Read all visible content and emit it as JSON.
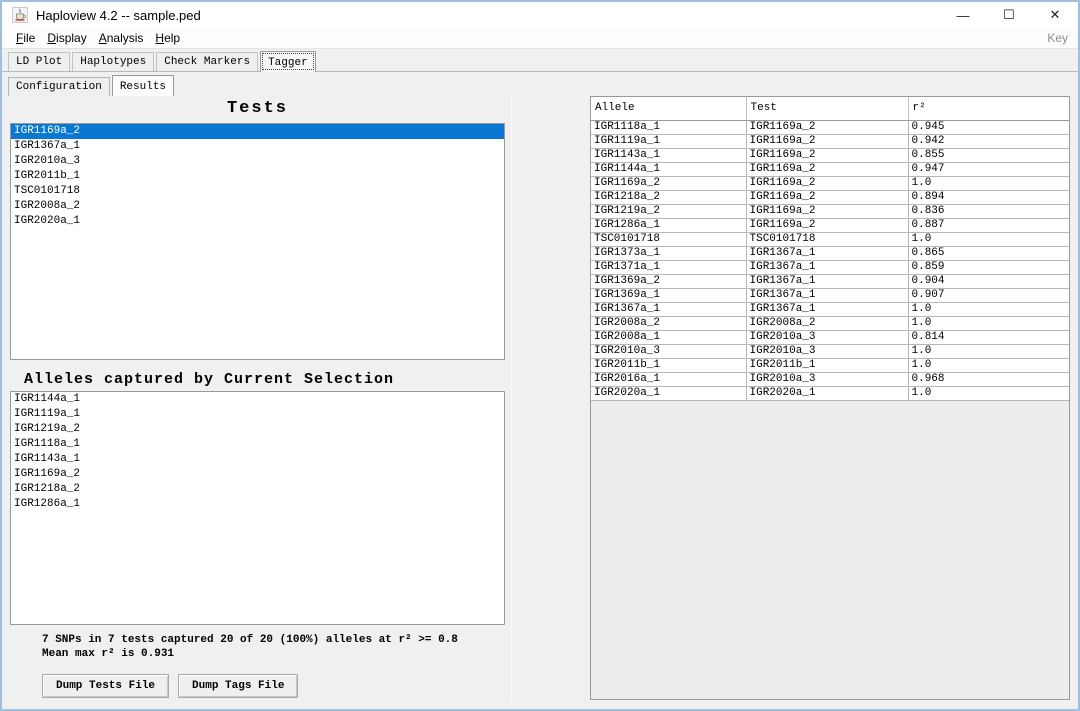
{
  "window": {
    "title": "Haploview 4.2 -- sample.ped",
    "controls": {
      "minimize": "—",
      "maximize": "☐",
      "close": "✕"
    }
  },
  "menu": {
    "items": [
      "File",
      "Display",
      "Analysis",
      "Help"
    ],
    "right_label": "Key"
  },
  "main_tabs": {
    "items": [
      "LD Plot",
      "Haplotypes",
      "Check Markers",
      "Tagger"
    ],
    "selected": "Tagger"
  },
  "sub_tabs": {
    "items": [
      "Configuration",
      "Results"
    ],
    "selected": "Results"
  },
  "tests_panel": {
    "title": "Tests",
    "items": [
      "IGR1169a_2",
      "IGR1367a_1",
      "IGR2010a_3",
      "IGR2011b_1",
      "TSC0101718",
      "IGR2008a_2",
      "IGR2020a_1"
    ],
    "selected": "IGR1169a_2"
  },
  "alleles_panel": {
    "title": "Alleles captured by Current Selection",
    "items": [
      "IGR1144a_1",
      "IGR1119a_1",
      "IGR1219a_2",
      "IGR1118a_1",
      "IGR1143a_1",
      "IGR1169a_2",
      "IGR1218a_2",
      "IGR1286a_1"
    ]
  },
  "status": {
    "line1": "7 SNPs in 7 tests captured 20 of 20 (100%) alleles at r² >= 0.8",
    "line2": "Mean max r² is 0.931"
  },
  "buttons": {
    "dump_tests": "Dump Tests File",
    "dump_tags": "Dump Tags File"
  },
  "results_table": {
    "columns": [
      "Allele",
      "Test",
      "r²"
    ],
    "rows": [
      [
        "IGR1118a_1",
        "IGR1169a_2",
        "0.945"
      ],
      [
        "IGR1119a_1",
        "IGR1169a_2",
        "0.942"
      ],
      [
        "IGR1143a_1",
        "IGR1169a_2",
        "0.855"
      ],
      [
        "IGR1144a_1",
        "IGR1169a_2",
        "0.947"
      ],
      [
        "IGR1169a_2",
        "IGR1169a_2",
        "1.0"
      ],
      [
        "IGR1218a_2",
        "IGR1169a_2",
        "0.894"
      ],
      [
        "IGR1219a_2",
        "IGR1169a_2",
        "0.836"
      ],
      [
        "IGR1286a_1",
        "IGR1169a_2",
        "0.887"
      ],
      [
        "TSC0101718",
        "TSC0101718",
        "1.0"
      ],
      [
        "IGR1373a_1",
        "IGR1367a_1",
        "0.865"
      ],
      [
        "IGR1371a_1",
        "IGR1367a_1",
        "0.859"
      ],
      [
        "IGR1369a_2",
        "IGR1367a_1",
        "0.904"
      ],
      [
        "IGR1369a_1",
        "IGR1367a_1",
        "0.907"
      ],
      [
        "IGR1367a_1",
        "IGR1367a_1",
        "1.0"
      ],
      [
        "IGR2008a_2",
        "IGR2008a_2",
        "1.0"
      ],
      [
        "IGR2008a_1",
        "IGR2010a_3",
        "0.814"
      ],
      [
        "IGR2010a_3",
        "IGR2010a_3",
        "1.0"
      ],
      [
        "IGR2011b_1",
        "IGR2011b_1",
        "1.0"
      ],
      [
        "IGR2016a_1",
        "IGR2010a_3",
        "0.968"
      ],
      [
        "IGR2020a_1",
        "IGR2020a_1",
        "1.0"
      ]
    ]
  },
  "colors": {
    "selection_bg": "#0a78d0",
    "selection_fg": "#ffffff",
    "window_border": "#9dbfe0"
  }
}
